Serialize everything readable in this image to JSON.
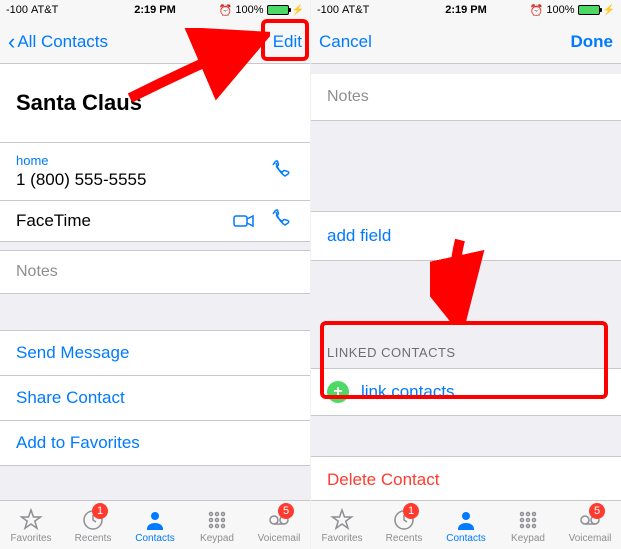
{
  "status": {
    "signal": "-100",
    "carrier": "AT&T",
    "time": "2:19 PM",
    "alarm_glyph": "⏰",
    "battery_pct": "100%"
  },
  "left_phone": {
    "nav": {
      "back": "All Contacts",
      "edit": "Edit"
    },
    "contact_name": "Santa Claus",
    "phone_label": "home",
    "phone_value": "1 (800) 555-5555",
    "facetime_label": "FaceTime",
    "notes_label": "Notes",
    "actions": {
      "send_message": "Send Message",
      "share_contact": "Share Contact",
      "add_favorites": "Add to Favorites"
    }
  },
  "right_phone": {
    "nav": {
      "cancel": "Cancel",
      "done": "Done"
    },
    "notes_label": "Notes",
    "add_field": "add field",
    "linked_header": "LINKED CONTACTS",
    "link_contacts": "link contacts…",
    "delete_contact": "Delete Contact"
  },
  "tabs": {
    "favorites": "Favorites",
    "recents": "Recents",
    "contacts": "Contacts",
    "keypad": "Keypad",
    "voicemail": "Voicemail",
    "recents_badge": "1",
    "voicemail_badge": "5"
  }
}
